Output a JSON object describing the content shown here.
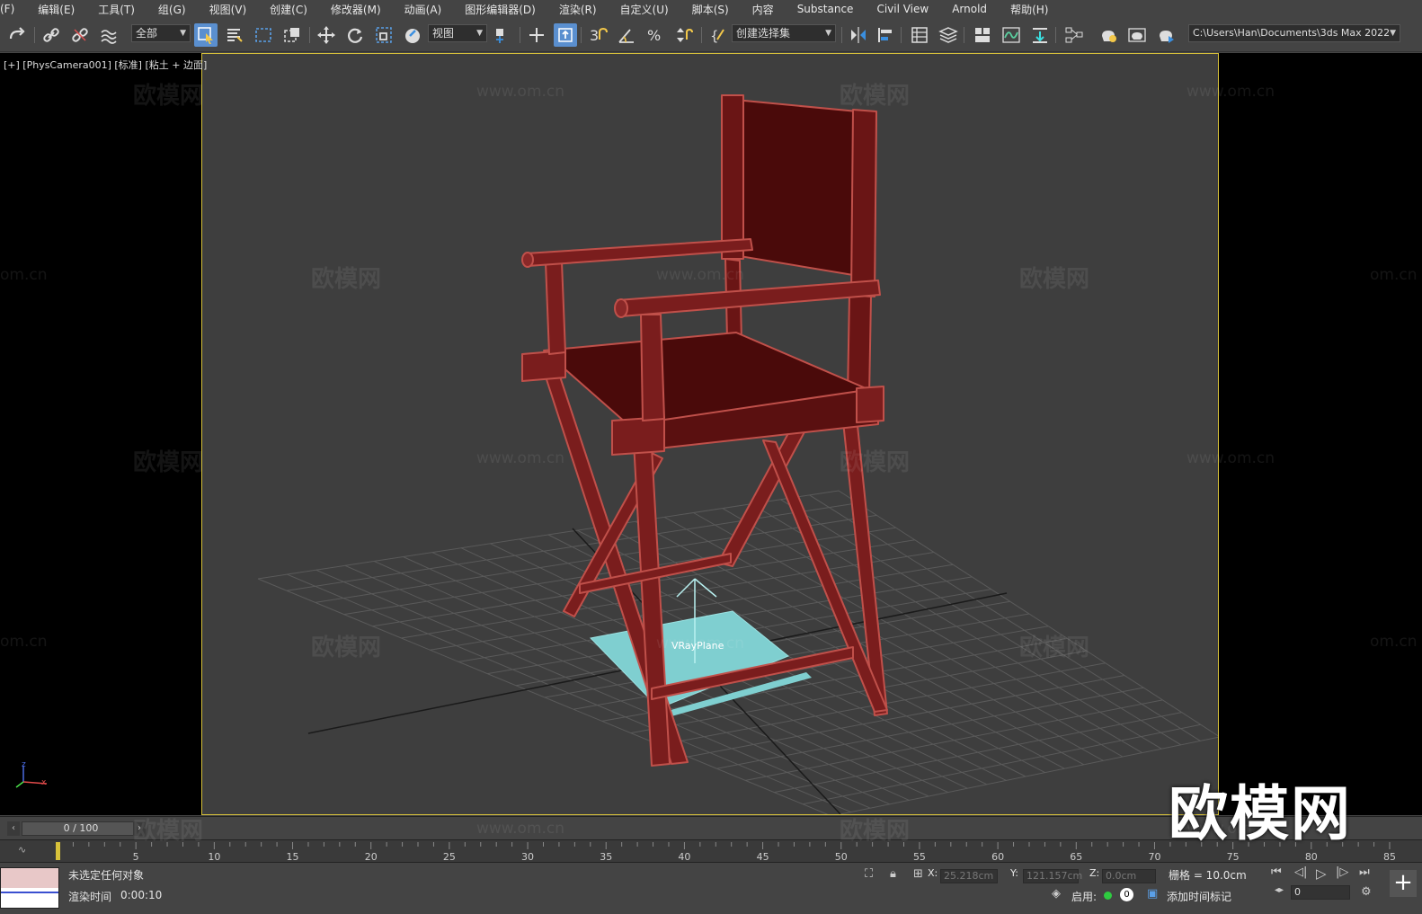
{
  "menu": [
    "(F)",
    "编辑(E)",
    "工具(T)",
    "组(G)",
    "视图(V)",
    "创建(C)",
    "修改器(M)",
    "动画(A)",
    "图形编辑器(D)",
    "渲染(R)",
    "自定义(U)",
    "脚本(S)",
    "内容",
    "Substance",
    "Civil View",
    "Arnold",
    "帮助(H)"
  ],
  "toolbar": {
    "selection_filter": "全部",
    "ref_coord": "视图",
    "named_selection": "创建选择集",
    "project_path": "C:\\Users\\Han\\Documents\\3ds Max 2022"
  },
  "viewport": {
    "label": "[+] [PhysCamera001] [标准] [粘土 + 边面]",
    "object_label": "VRayPlane",
    "watermark_brand": "欧模网",
    "watermark_url": "www.om.cn",
    "watermark_url_short": "om.cn",
    "logo_text": "欧模网",
    "axis_x": "x",
    "axis_z": "z",
    "colors": {
      "chair": "#5a1010",
      "chair_edges": "#c0504a",
      "plane": "#7fcfd0",
      "grid": "#5a5a5a",
      "border": "#d8c23a"
    }
  },
  "timeline": {
    "frame_display": "0 / 100",
    "ticks": [
      "5",
      "10",
      "15",
      "20",
      "25",
      "30",
      "35",
      "40",
      "45",
      "50",
      "55",
      "60",
      "65",
      "70",
      "75",
      "80",
      "85"
    ]
  },
  "status": {
    "selection_text": "未选定任何对象",
    "render_time_label": "渲染时间",
    "render_time_value": "0:00:10",
    "x_label": "X:",
    "x_value": "25.218cm",
    "y_label": "Y:",
    "y_value": "121.157cm",
    "z_label": "Z:",
    "z_value": "0.0cm",
    "grid_text": "栅格 = 10.0cm",
    "enable_label": "启用:",
    "enable_count": "0",
    "add_time_tag": "添加时间标记",
    "current_frame": "0"
  }
}
